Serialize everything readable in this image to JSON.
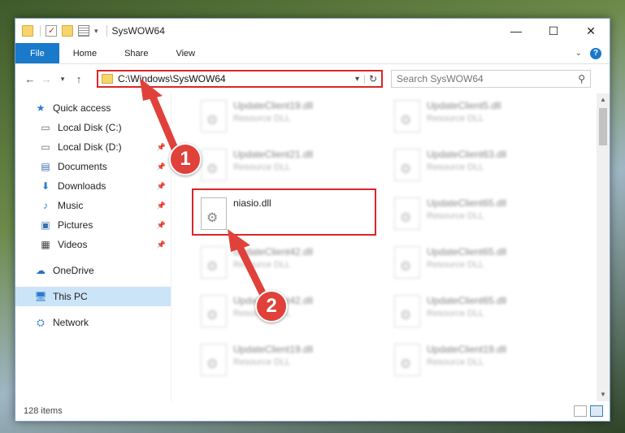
{
  "window": {
    "title": "SysWOW64",
    "controls": {
      "minimize": "—",
      "maximize": "☐",
      "close": "✕"
    }
  },
  "ribbon": {
    "tabs": [
      "File",
      "Home",
      "Share",
      "View"
    ],
    "expand_glyph": "⌄",
    "help_glyph": "?"
  },
  "address": {
    "path": "C:\\Windows\\SysWOW64",
    "search_placeholder": "Search SysWOW64"
  },
  "sidebar": {
    "items": [
      {
        "label": "Quick access",
        "icon": "star-icon",
        "pinned": false
      },
      {
        "label": "Local Disk (C:)",
        "icon": "drive-icon",
        "pinned": false
      },
      {
        "label": "Local Disk (D:)",
        "icon": "drive-icon",
        "pinned": true
      },
      {
        "label": "Documents",
        "icon": "documents-icon",
        "pinned": true
      },
      {
        "label": "Downloads",
        "icon": "download-icon",
        "pinned": true
      },
      {
        "label": "Music",
        "icon": "music-icon",
        "pinned": true
      },
      {
        "label": "Pictures",
        "icon": "pictures-icon",
        "pinned": true
      },
      {
        "label": "Videos",
        "icon": "videos-icon",
        "pinned": true
      },
      {
        "label": "OneDrive",
        "icon": "cloud-icon",
        "pinned": false
      },
      {
        "label": "This PC",
        "icon": "computer-icon",
        "pinned": false,
        "selected": true
      },
      {
        "label": "Network",
        "icon": "network-icon",
        "pinned": false
      }
    ]
  },
  "files": [
    {
      "name": "UpdateClient19.dll",
      "type": "Resource DLL",
      "blurred": true
    },
    {
      "name": "UpdateClient5.dll",
      "type": "Resource DLL",
      "blurred": true
    },
    {
      "name": "UpdateClient21.dll",
      "type": "Resource DLL",
      "blurred": true
    },
    {
      "name": "UpdateClient63.dll",
      "type": "Resource DLL",
      "blurred": true
    },
    {
      "name": "niasio.dll",
      "type": "",
      "blurred": false,
      "highlighted": true
    },
    {
      "name": "UpdateClient65.dll",
      "type": "Resource DLL",
      "blurred": true
    },
    {
      "name": "UpdateClient42.dll",
      "type": "Resource DLL",
      "blurred": true
    },
    {
      "name": "UpdateClient65.dll",
      "type": "Resource DLL",
      "blurred": true
    },
    {
      "name": "UpdateClient42.dll",
      "type": "Resource DLL",
      "blurred": true
    },
    {
      "name": "UpdateClient65.dll",
      "type": "Resource DLL",
      "blurred": true
    },
    {
      "name": "UpdateClient19.dll",
      "type": "Resource DLL",
      "blurred": true
    },
    {
      "name": "UpdateClient19.dll",
      "type": "Resource DLL",
      "blurred": true
    }
  ],
  "status": {
    "item_count": "128 items"
  },
  "annotations": [
    {
      "number": "1",
      "color": "#e0413a"
    },
    {
      "number": "2",
      "color": "#e0413a"
    }
  ]
}
